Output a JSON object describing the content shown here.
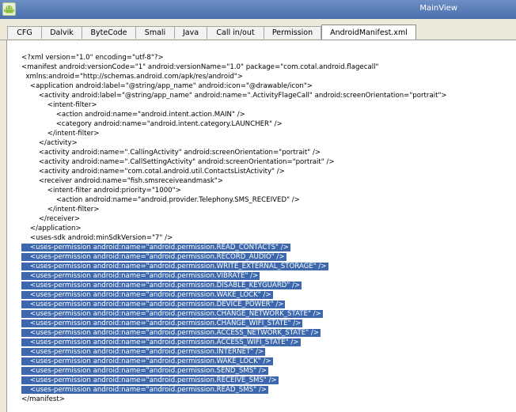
{
  "window": {
    "title": "MainView"
  },
  "tabs": [
    {
      "label": "CFG",
      "active": false
    },
    {
      "label": "Dalvik",
      "active": false
    },
    {
      "label": "ByteCode",
      "active": false
    },
    {
      "label": "Smali",
      "active": false
    },
    {
      "label": "Java",
      "active": false
    },
    {
      "label": "Call in/out",
      "active": false
    },
    {
      "label": "Permission",
      "active": false
    },
    {
      "label": "AndroidManifest.xml",
      "active": true
    }
  ],
  "editor": {
    "selection_color": "#3d68ad",
    "lines": [
      {
        "text": "<?xml version=\"1.0\" encoding=\"utf-8\"?>",
        "selected": false
      },
      {
        "text": "<manifest android:versionCode=\"1\" android:versionName=\"1.0\" package=\"com.cotal.android.flagecall\"",
        "selected": false
      },
      {
        "text": "  xmlns:android=\"http://schemas.android.com/apk/res/android\">",
        "selected": false
      },
      {
        "text": "    <application android:label=\"@string/app_name\" android:icon=\"@drawable/icon\">",
        "selected": false
      },
      {
        "text": "        <activity android:label=\"@string/app_name\" android:name=\".ActivityFlageCall\" android:screenOrientation=\"portrait\">",
        "selected": false
      },
      {
        "text": "            <intent-filter>",
        "selected": false
      },
      {
        "text": "                <action android:name=\"android.intent.action.MAIN\" />",
        "selected": false
      },
      {
        "text": "                <category android:name=\"android.intent.category.LAUNCHER\" />",
        "selected": false
      },
      {
        "text": "            </intent-filter>",
        "selected": false
      },
      {
        "text": "        </activity>",
        "selected": false
      },
      {
        "text": "        <activity android:name=\".CallingActivity\" android:screenOrientation=\"portrait\" />",
        "selected": false
      },
      {
        "text": "        <activity android:name=\".CallSettingActivity\" android:screenOrientation=\"portrait\" />",
        "selected": false
      },
      {
        "text": "        <activity android:name=\"com.cotal.android.util.ContactsListActivity\" />",
        "selected": false
      },
      {
        "text": "        <receiver android:name=\"fish.smsreceiveandmask\">",
        "selected": false
      },
      {
        "text": "            <intent-filter android:priority=\"1000\">",
        "selected": false
      },
      {
        "text": "                <action android:name=\"android.provider.Telephony.SMS_RECEIVED\" />",
        "selected": false
      },
      {
        "text": "            </intent-filter>",
        "selected": false
      },
      {
        "text": "        </receiver>",
        "selected": false
      },
      {
        "text": "    </application>",
        "selected": false
      },
      {
        "text": "    <uses-sdk android:minSdkVersion=\"7\" />",
        "selected": false
      },
      {
        "text": "    <uses-permission android:name=\"android.permission.READ_CONTACTS\" />",
        "selected": true
      },
      {
        "text": "    <uses-permission android:name=\"android.permission.RECORD_AUDIO\" />",
        "selected": true
      },
      {
        "text": "    <uses-permission android:name=\"android.permission.WRITE_EXTERNAL_STORAGE\" />",
        "selected": true
      },
      {
        "text": "    <uses-permission android:name=\"android.permission.VIBRATE\" />",
        "selected": true
      },
      {
        "text": "    <uses-permission android:name=\"android.permission.DISABLE_KEYGUARD\" />",
        "selected": true
      },
      {
        "text": "    <uses-permission android:name=\"android.permission.WAKE_LOCK\" />",
        "selected": true
      },
      {
        "text": "    <uses-permission android:name=\"android.permission.DEVICE_POWER\" />",
        "selected": true
      },
      {
        "text": "    <uses-permission android:name=\"android.permission.CHANGE_NETWORK_STATE\" />",
        "selected": true
      },
      {
        "text": "    <uses-permission android:name=\"android.permission.CHANGE_WIFI_STATE\" />",
        "selected": true
      },
      {
        "text": "    <uses-permission android:name=\"android.permission.ACCESS_NETWORK_STATE\" />",
        "selected": true
      },
      {
        "text": "    <uses-permission android:name=\"android.permission.ACCESS_WIFI_STATE\" />",
        "selected": true
      },
      {
        "text": "    <uses-permission android:name=\"android.permission.INTERNET\" />",
        "selected": true
      },
      {
        "text": "    <uses-permission android:name=\"android.permission.WAKE_LOCK\" />",
        "selected": true
      },
      {
        "text": "    <uses-permission android:name=\"android.permission.SEND_SMS\" />",
        "selected": true
      },
      {
        "text": "    <uses-permission android:name=\"android.permission.RECEIVE_SMS\" />",
        "selected": true
      },
      {
        "text": "    <uses-permission android:name=\"android.permission.READ_SMS\" />",
        "selected": true
      },
      {
        "text": "</manifest>",
        "selected": false
      }
    ]
  }
}
